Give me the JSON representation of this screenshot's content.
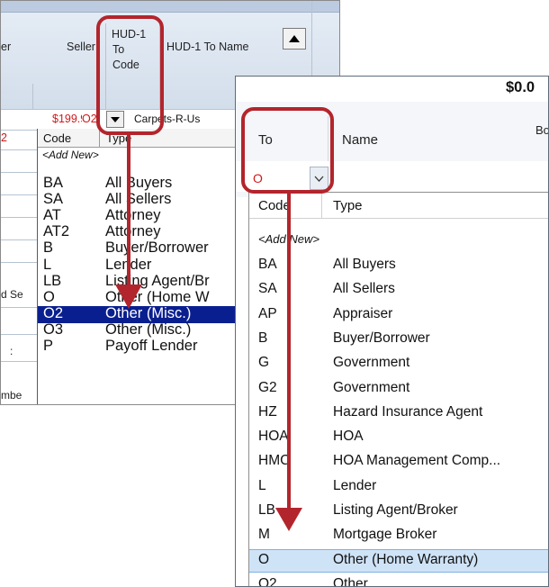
{
  "back_window": {
    "columns": {
      "partial_left": "er",
      "seller": "Seller",
      "hud1_to_code_lines": [
        "HUD-1",
        "To",
        "Code"
      ],
      "hud1_to_name": "HUD-1 To Name"
    },
    "amount": "$199.99",
    "code_value": "O2",
    "name_value": "Carpets-R-Us",
    "left_red_value": "2",
    "left_labels": [
      "d Se",
      ":",
      "mbe"
    ],
    "list": {
      "header_code": "Code",
      "header_type": "Type",
      "add_new": "<Add New>",
      "rows": [
        {
          "code": "BA",
          "type": "All Buyers"
        },
        {
          "code": "SA",
          "type": "All Sellers"
        },
        {
          "code": "AT",
          "type": "Attorney"
        },
        {
          "code": "AT2",
          "type": "Attorney"
        },
        {
          "code": "B",
          "type": "Buyer/Borrower"
        },
        {
          "code": "L",
          "type": "Lender"
        },
        {
          "code": "LB",
          "type": "Listing Agent/Br"
        },
        {
          "code": "O",
          "type": "Other (Home W"
        },
        {
          "code": "O2",
          "type": "Other (Misc.)"
        },
        {
          "code": "O3",
          "type": "Other (Misc.)"
        },
        {
          "code": "P",
          "type": "Payoff Lender"
        }
      ],
      "selected_code": "O2",
      "selected_color": "#0a1f8f"
    }
  },
  "front_window": {
    "amount": "$0.0",
    "col_to": "To",
    "col_name": "Name",
    "col_partial": "Bo",
    "code_value": "O",
    "list": {
      "header_code": "Code",
      "header_type": "Type",
      "add_new": "<Add New>",
      "rows": [
        {
          "code": "BA",
          "type": "All Buyers"
        },
        {
          "code": "SA",
          "type": "All Sellers"
        },
        {
          "code": "AP",
          "type": "Appraiser"
        },
        {
          "code": "B",
          "type": "Buyer/Borrower"
        },
        {
          "code": "G",
          "type": "Government"
        },
        {
          "code": "G2",
          "type": "Government"
        },
        {
          "code": "HZ",
          "type": "Hazard Insurance Agent"
        },
        {
          "code": "HOA",
          "type": "HOA"
        },
        {
          "code": "HMC",
          "type": "HOA Management Comp..."
        },
        {
          "code": "L",
          "type": "Lender"
        },
        {
          "code": "LB",
          "type": "Listing Agent/Broker"
        },
        {
          "code": "M",
          "type": "Mortgage Broker"
        },
        {
          "code": "O",
          "type": "Other (Home Warranty)"
        },
        {
          "code": "O2",
          "type": "Other"
        }
      ],
      "selected_code": "O",
      "selected_color": "#cfe3f7"
    }
  },
  "icons": {
    "dropdown": "chevron-down-icon",
    "scroll_up": "scroll-up-arrow-icon",
    "callout_arrow": "arrow-down-icon"
  },
  "colors": {
    "callout": "#b3252c",
    "value_red": "#d0171b"
  }
}
